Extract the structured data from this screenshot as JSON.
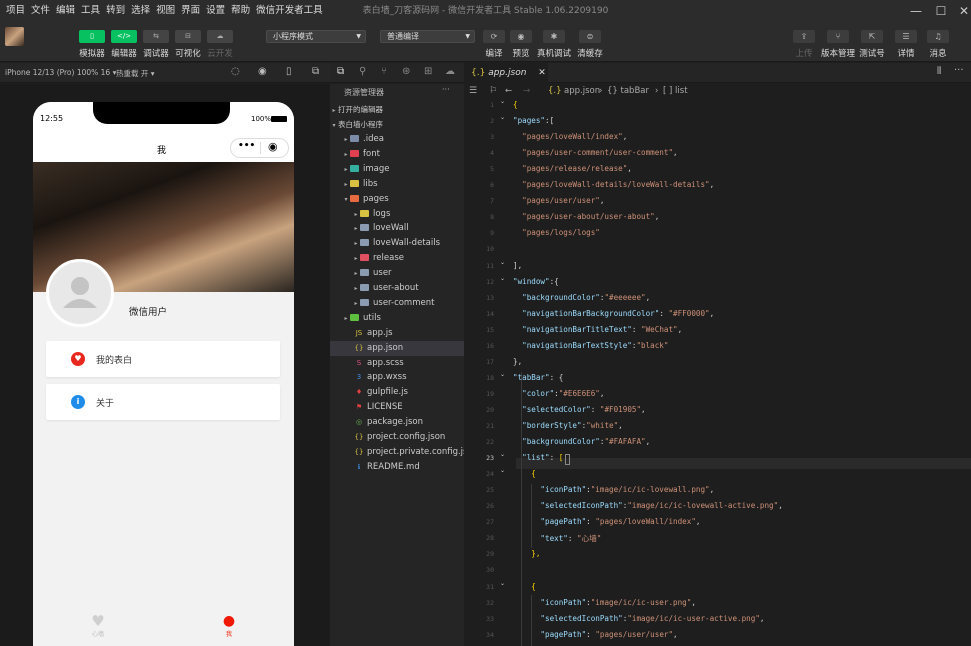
{
  "menu": [
    "项目",
    "文件",
    "编辑",
    "工具",
    "转到",
    "选择",
    "视图",
    "界面",
    "设置",
    "帮助",
    "微信开发者工具"
  ],
  "window_title": "表白墙_刀客源码网 - 微信开发者工具 Stable 1.06.2209190",
  "toolbar": {
    "left": [
      {
        "label": "模拟器",
        "glyph": "▯",
        "on": true
      },
      {
        "label": "编辑器",
        "glyph": "</>",
        "on": true
      },
      {
        "label": "调试器",
        "glyph": "⇆",
        "on": false
      },
      {
        "label": "可视化",
        "glyph": "⊟",
        "on": false
      },
      {
        "label": "云开发",
        "glyph": "☁",
        "on": false,
        "dim": true
      }
    ],
    "mode_select": "小程序模式",
    "compile_select": "普通编译",
    "mid": [
      {
        "label": "编译",
        "glyph": "⟳"
      },
      {
        "label": "预览",
        "glyph": "◉"
      },
      {
        "label": "真机调试",
        "glyph": "✱"
      },
      {
        "label": "清缓存",
        "glyph": "⊜"
      }
    ],
    "right": [
      {
        "label": "上传",
        "glyph": "⇪",
        "dim": true
      },
      {
        "label": "版本管理",
        "glyph": "⑂"
      },
      {
        "label": "测试号",
        "glyph": "⇱"
      },
      {
        "label": "详情",
        "glyph": "☰"
      },
      {
        "label": "消息",
        "glyph": "♫"
      }
    ]
  },
  "sim": {
    "device": "iPhone 12/13 (Pro) 100% 16 ▾",
    "hotreload": "热重载 开 ▾",
    "time": "12:55",
    "battery": "100%",
    "nav_title": "我",
    "user_name": "微信用户",
    "items": [
      {
        "label": "我的表白",
        "icon": "heart-icon",
        "color": "#e8281e"
      },
      {
        "label": "关于",
        "icon": "info-icon",
        "color": "#1e8ce8"
      }
    ],
    "tabs": [
      {
        "label": "心墙",
        "color": "#bbbbbb"
      },
      {
        "label": "我",
        "color": "#f01905"
      }
    ]
  },
  "explorer": {
    "title": "资源管理器",
    "more": "···",
    "open_editors": "打开的编辑器",
    "project": "表白墙小程序",
    "tree": [
      {
        "name": ".idea",
        "kind": "folder",
        "color": "#7a8ca8",
        "depth": 1
      },
      {
        "name": "font",
        "kind": "folder",
        "color": "#e04050",
        "depth": 1
      },
      {
        "name": "image",
        "kind": "folder",
        "color": "#35b0a0",
        "depth": 1
      },
      {
        "name": "libs",
        "kind": "folder",
        "color": "#d8c040",
        "depth": 1
      },
      {
        "name": "pages",
        "kind": "folder-open",
        "color": "#e86a40",
        "depth": 1
      },
      {
        "name": "logs",
        "kind": "folder",
        "color": "#d8c040",
        "depth": 2
      },
      {
        "name": "loveWall",
        "kind": "folder",
        "color": "#8a9ab0",
        "depth": 2
      },
      {
        "name": "loveWall-details",
        "kind": "folder",
        "color": "#8a9ab0",
        "depth": 2
      },
      {
        "name": "release",
        "kind": "folder",
        "color": "#e05060",
        "depth": 2
      },
      {
        "name": "user",
        "kind": "folder",
        "color": "#8a9ab0",
        "depth": 2
      },
      {
        "name": "user-about",
        "kind": "folder",
        "color": "#8a9ab0",
        "depth": 2
      },
      {
        "name": "user-comment",
        "kind": "folder",
        "color": "#8a9ab0",
        "depth": 2
      },
      {
        "name": "utils",
        "kind": "folder",
        "color": "#5fc040",
        "depth": 1
      },
      {
        "name": "app.js",
        "kind": "file",
        "icon": "JS",
        "color": "#d8c040",
        "depth": 1
      },
      {
        "name": "app.json",
        "kind": "file",
        "icon": "{}",
        "color": "#d8c040",
        "depth": 1,
        "selected": true
      },
      {
        "name": "app.scss",
        "kind": "file",
        "icon": "S",
        "color": "#e05080",
        "depth": 1
      },
      {
        "name": "app.wxss",
        "kind": "file",
        "icon": "3",
        "color": "#3a8ce0",
        "depth": 1
      },
      {
        "name": "gulpfile.js",
        "kind": "file",
        "icon": "♦",
        "color": "#e04040",
        "depth": 1
      },
      {
        "name": "LICENSE",
        "kind": "file",
        "icon": "⚑",
        "color": "#e04040",
        "depth": 1
      },
      {
        "name": "package.json",
        "kind": "file",
        "icon": "◎",
        "color": "#6ab04c",
        "depth": 1
      },
      {
        "name": "project.config.json",
        "kind": "file",
        "icon": "{}",
        "color": "#d8c040",
        "depth": 1
      },
      {
        "name": "project.private.config.js...",
        "kind": "file",
        "icon": "{}",
        "color": "#d8c040",
        "depth": 1
      },
      {
        "name": "README.md",
        "kind": "file",
        "icon": "ℹ",
        "color": "#3a8ce0",
        "depth": 1
      }
    ]
  },
  "editor": {
    "tab": "app.json",
    "breadcrumb": [
      "app.json",
      "{} tabBar",
      "[ ] list"
    ],
    "lines": [
      {
        "n": "1",
        "t": [
          [
            "b",
            "{"
          ]
        ]
      },
      {
        "n": "2",
        "t": [
          [
            "k",
            "\"pages\""
          ],
          [
            "p",
            ":["
          ]
        ]
      },
      {
        "n": "3",
        "t": [
          [
            "s",
            "  \"pages/loveWall/index\""
          ],
          [
            "p",
            ","
          ]
        ]
      },
      {
        "n": "4",
        "t": [
          [
            "s",
            "  \"pages/user-comment/user-comment\""
          ],
          [
            "p",
            ","
          ]
        ]
      },
      {
        "n": "5",
        "t": [
          [
            "s",
            "  \"pages/release/release\""
          ],
          [
            "p",
            ","
          ]
        ]
      },
      {
        "n": "6",
        "t": [
          [
            "s",
            "  \"pages/loveWall-details/loveWall-details\""
          ],
          [
            "p",
            ","
          ]
        ]
      },
      {
        "n": "7",
        "t": [
          [
            "s",
            "  \"pages/user/user\""
          ],
          [
            "p",
            ","
          ]
        ]
      },
      {
        "n": "8",
        "t": [
          [
            "s",
            "  \"pages/user-about/user-about\""
          ],
          [
            "p",
            ","
          ]
        ]
      },
      {
        "n": "9",
        "t": [
          [
            "s",
            "  \"pages/logs/logs\""
          ]
        ]
      },
      {
        "n": "10",
        "t": []
      },
      {
        "n": "11",
        "t": [
          [
            "p",
            "],"
          ]
        ]
      },
      {
        "n": "12",
        "t": [
          [
            "k",
            "\"window\""
          ],
          [
            "p",
            ":{"
          ]
        ]
      },
      {
        "n": "13",
        "t": [
          [
            "k",
            "  \"backgroundColor\""
          ],
          [
            "p",
            ":"
          ],
          [
            "s",
            "\"#eeeeee\""
          ],
          [
            "p",
            ","
          ]
        ]
      },
      {
        "n": "14",
        "t": [
          [
            "k",
            "  \"navigationBarBackgroundColor\""
          ],
          [
            "p",
            ": "
          ],
          [
            "s",
            "\"#FF0000\""
          ],
          [
            "p",
            ","
          ]
        ]
      },
      {
        "n": "15",
        "t": [
          [
            "k",
            "  \"navigationBarTitleText\""
          ],
          [
            "p",
            ": "
          ],
          [
            "s",
            "\"WeChat\""
          ],
          [
            "p",
            ","
          ]
        ]
      },
      {
        "n": "16",
        "t": [
          [
            "k",
            "  \"navigationBarTextStyle\""
          ],
          [
            "p",
            ":"
          ],
          [
            "s",
            "\"black\""
          ]
        ]
      },
      {
        "n": "17",
        "t": [
          [
            "p",
            "},"
          ]
        ]
      },
      {
        "n": "18",
        "t": [
          [
            "k",
            "\"tabBar\""
          ],
          [
            "p",
            ": {"
          ]
        ]
      },
      {
        "n": "19",
        "t": [
          [
            "k",
            "  \"color\""
          ],
          [
            "p",
            ":"
          ],
          [
            "s",
            "\"#E6E6E6\""
          ],
          [
            "p",
            ","
          ]
        ]
      },
      {
        "n": "20",
        "t": [
          [
            "k",
            "  \"selectedColor\""
          ],
          [
            "p",
            ": "
          ],
          [
            "s",
            "\"#F01905\""
          ],
          [
            "p",
            ","
          ]
        ]
      },
      {
        "n": "21",
        "t": [
          [
            "k",
            "  \"borderStyle\""
          ],
          [
            "p",
            ":"
          ],
          [
            "s",
            "\"white\""
          ],
          [
            "p",
            ","
          ]
        ]
      },
      {
        "n": "22",
        "t": [
          [
            "k",
            "  \"backgroundColor\""
          ],
          [
            "p",
            ":"
          ],
          [
            "s",
            "\"#FAFAFA\""
          ],
          [
            "p",
            ","
          ]
        ]
      },
      {
        "n": "23",
        "t": [
          [
            "k",
            "  \"list\""
          ],
          [
            "p",
            ": "
          ],
          [
            "b",
            "["
          ]
        ]
      },
      {
        "n": "24",
        "t": [
          [
            "b",
            "    {"
          ]
        ]
      },
      {
        "n": "25",
        "t": [
          [
            "k",
            "      \"iconPath\""
          ],
          [
            "p",
            ":"
          ],
          [
            "s",
            "\"image/ic/ic-lovewall.png\""
          ],
          [
            "p",
            ","
          ]
        ]
      },
      {
        "n": "26",
        "t": [
          [
            "k",
            "      \"selectedIconPath\""
          ],
          [
            "p",
            ":"
          ],
          [
            "s",
            "\"image/ic/ic-lovewall-active.png\""
          ],
          [
            "p",
            ","
          ]
        ]
      },
      {
        "n": "27",
        "t": [
          [
            "k",
            "      \"pagePath\""
          ],
          [
            "p",
            ": "
          ],
          [
            "s",
            "\"pages/loveWall/index\""
          ],
          [
            "p",
            ","
          ]
        ]
      },
      {
        "n": "28",
        "t": [
          [
            "k",
            "      \"text\""
          ],
          [
            "p",
            ": "
          ],
          [
            "s",
            "\"心墙\""
          ]
        ]
      },
      {
        "n": "29",
        "t": [
          [
            "b",
            "    },"
          ]
        ]
      },
      {
        "n": "30",
        "t": []
      },
      {
        "n": "31",
        "t": [
          [
            "b",
            "    {"
          ]
        ]
      },
      {
        "n": "32",
        "t": [
          [
            "k",
            "      \"iconPath\""
          ],
          [
            "p",
            ":"
          ],
          [
            "s",
            "\"image/ic/ic-user.png\""
          ],
          [
            "p",
            ","
          ]
        ]
      },
      {
        "n": "33",
        "t": [
          [
            "k",
            "      \"selectedIconPath\""
          ],
          [
            "p",
            ":"
          ],
          [
            "s",
            "\"image/ic/ic-user-active.png\""
          ],
          [
            "p",
            ","
          ]
        ]
      },
      {
        "n": "34",
        "t": [
          [
            "k",
            "      \"pagePath\""
          ],
          [
            "p",
            ": "
          ],
          [
            "s",
            "\"pages/user/user\""
          ],
          [
            "p",
            ","
          ]
        ]
      }
    ]
  }
}
